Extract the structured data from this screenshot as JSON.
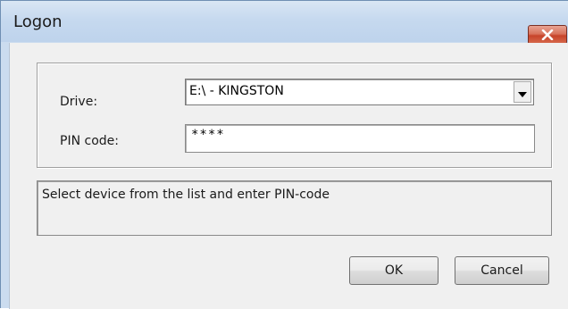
{
  "window": {
    "title": "Logon"
  },
  "form": {
    "drive_label": "Drive:",
    "drive_value": "E:\\ - KINGSTON",
    "pin_label": "PIN code:",
    "pin_value": "****"
  },
  "status": {
    "message": "Select device from the list and enter PIN-code"
  },
  "buttons": {
    "ok_label": "OK",
    "cancel_label": "Cancel"
  },
  "icons": {
    "close": "close-icon",
    "dropdown": "chevron-down-icon"
  },
  "colors": {
    "titlebar": "#c6d9ef",
    "close_button": "#c7432a",
    "client_background": "#f0f0f0"
  }
}
